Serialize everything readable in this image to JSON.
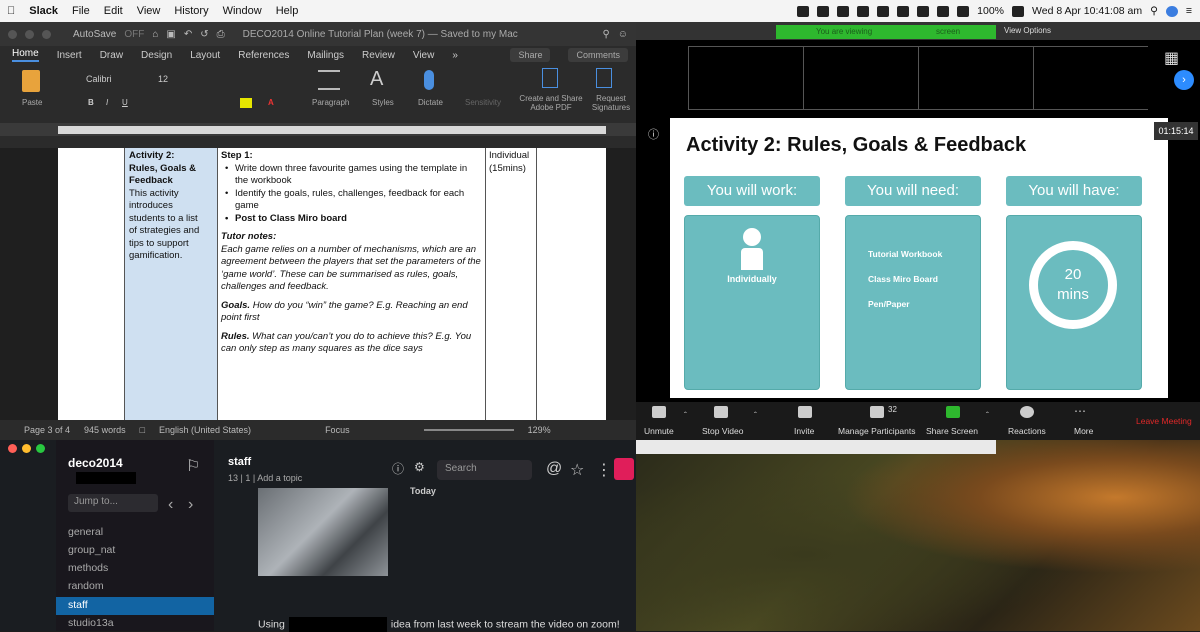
{
  "menubar": {
    "app": "Slack",
    "items": [
      "File",
      "Edit",
      "View",
      "History",
      "Window",
      "Help"
    ],
    "battery": "100%",
    "clock": "Wed 8 Apr  10:41:08 am"
  },
  "word": {
    "autosave": "AutoSave",
    "autosave_state": "OFF",
    "title": "DECO2014 Online Tutorial Plan (week 7) — Saved to my Mac",
    "tabs": [
      "Home",
      "Insert",
      "Draw",
      "Design",
      "Layout",
      "References",
      "Mailings",
      "Review",
      "View"
    ],
    "share_label": "Share",
    "comments_label": "Comments",
    "ribbon": {
      "paste": "Paste",
      "font": "Calibri",
      "size": "12",
      "paragraph": "Paragraph",
      "styles": "Styles",
      "dictate": "Dictate",
      "sensitivity": "Sensitivity",
      "create_share": "Create and Share Adobe PDF",
      "request_sign": "Request Signatures"
    },
    "table": {
      "col1": [
        "Activity 2:",
        "Rules, Goals &",
        "Feedback",
        "This activity",
        "introduces",
        "students to a list",
        "of strategies and",
        "tips to support",
        "gamification."
      ],
      "col2_step": "Step 1:",
      "bullets": [
        "Write down three favourite games using the template in the workbook",
        "Identify the goals, rules, challenges, feedback for each game",
        "Post to Class Miro board"
      ],
      "tutor_notes_label": "Tutor notes:",
      "tutor_notes": "Each game relies on a number of mechanisms, which are an agreement between the players that set the parameters of the ‘game world’. These can be summarised as rules, goals, challenges and feedback.",
      "goals_label": "Goals.",
      "goals_text": "How do you “win” the game? E.g. Reaching an end point first",
      "rules_label": "Rules.",
      "rules_text": "What can you/can’t you do to achieve this? E.g. You can only step as many squares as the dice says",
      "col3": [
        "Individual",
        "(15mins)"
      ]
    },
    "status": {
      "page": "Page 3 of 4",
      "words": "945 words",
      "lang": "English (United States)",
      "focus": "Focus",
      "zoom": "129%"
    }
  },
  "slack": {
    "workspace": "deco2014",
    "jump": "Jump to...",
    "channels": [
      "general",
      "group_nat",
      "methods",
      "random",
      "staff",
      "studio13a"
    ],
    "selected": "staff",
    "channel_header": "staff",
    "channel_meta": "13  |  1  |  Add a topic",
    "search": "Search",
    "today": "Today",
    "message_before": "Using",
    "message_after": "idea from last week to stream the video on zoom!"
  },
  "zoom": {
    "viewing": "You are viewing",
    "screen": "screen",
    "view_options": "View Options",
    "timer": "01:15:14",
    "slide": {
      "title": "Activity 2: Rules, Goals & Feedback",
      "headers": [
        "You will work:",
        "You will need:",
        "You will have:"
      ],
      "work": "Individually",
      "need": [
        "Tutorial Workbook",
        "Class Miro Board",
        "Pen/Paper"
      ],
      "have_num": "20",
      "have_unit": "mins"
    },
    "toolbar": {
      "unmute": "Unmute",
      "stop_video": "Stop Video",
      "invite": "Invite",
      "manage": "Manage Participants",
      "participants": "32",
      "share": "Share Screen",
      "reactions": "Reactions",
      "more": "More",
      "leave": "Leave Meeting"
    }
  }
}
